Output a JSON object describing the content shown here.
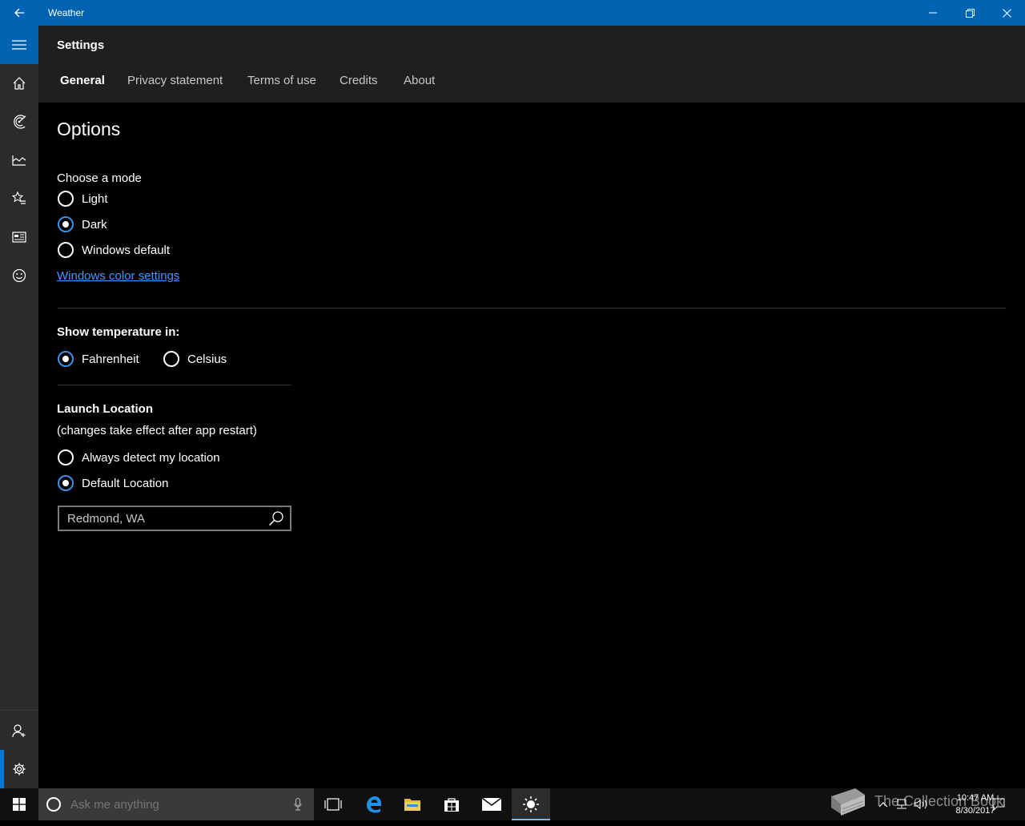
{
  "window": {
    "title": "Weather"
  },
  "header": {
    "title": "Settings",
    "tabs": [
      {
        "label": "General"
      },
      {
        "label": "Privacy statement"
      },
      {
        "label": "Terms of use"
      },
      {
        "label": "Credits"
      },
      {
        "label": "About"
      }
    ]
  },
  "options": {
    "heading": "Options",
    "mode_label": "Choose a mode",
    "modes": [
      {
        "label": "Light",
        "checked": false
      },
      {
        "label": "Dark",
        "checked": true
      },
      {
        "label": "Windows default",
        "checked": false
      }
    ],
    "color_link": "Windows color settings",
    "temp_label": "Show temperature in:",
    "temps": [
      {
        "label": "Fahrenheit",
        "checked": true
      },
      {
        "label": "Celsius",
        "checked": false
      }
    ],
    "launch_label": "Launch Location",
    "launch_note": "(changes take effect after app restart)",
    "launch_options": [
      {
        "label": "Always detect my location",
        "checked": false
      },
      {
        "label": "Default Location",
        "checked": true
      }
    ],
    "default_location_value": "Redmond, WA"
  },
  "taskbar": {
    "search_placeholder": "Ask me anything",
    "time": "10:47 AM",
    "date": "8/30/2017",
    "watermark": "The Collection Book"
  },
  "colors": {
    "accent": "#0063b1",
    "rail": "#2b2b2b",
    "header": "#1f1f1f",
    "link": "#3a9bff"
  },
  "icons": {
    "rail": [
      "hamburger-icon",
      "home-icon",
      "forecast-icon",
      "maps-icon",
      "historical-icon",
      "favorites-icon",
      "news-icon",
      "feedback-icon",
      "account-icon",
      "settings-icon"
    ]
  }
}
